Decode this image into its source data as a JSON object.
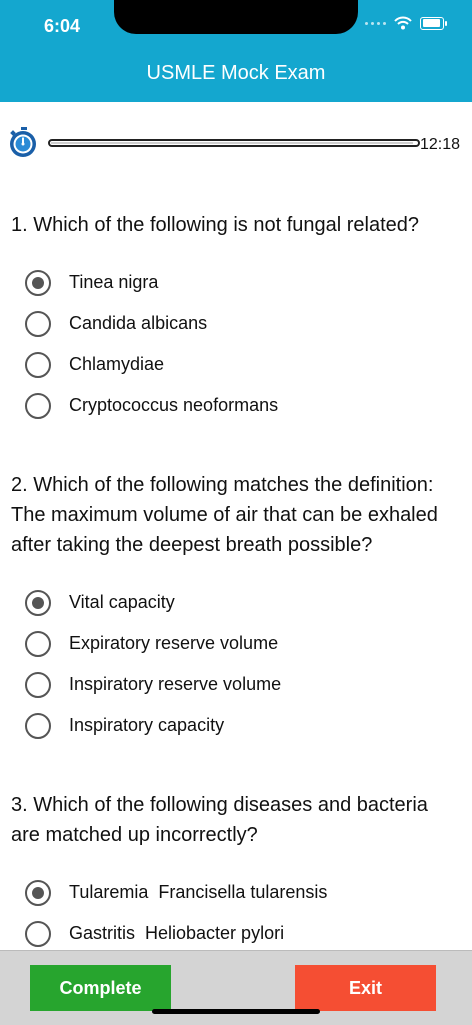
{
  "status_bar": {
    "time": "6:04"
  },
  "header": {
    "title": "USMLE Mock Exam"
  },
  "timer": {
    "remaining": "12:18",
    "progress_fraction": 0.99
  },
  "questions": [
    {
      "text": "1. Which of the following is not fungal related?",
      "options": [
        "Tinea nigra",
        "Candida albicans",
        "Chlamydiae",
        "Cryptococcus neoformans"
      ],
      "selected": 0
    },
    {
      "text": "2. Which of the following matches the definition: The maximum volume of air that can be exhaled after taking the deepest breath possible?",
      "options": [
        "Vital capacity",
        "Expiratory reserve volume",
        "Inspiratory reserve volume",
        "Inspiratory capacity"
      ],
      "selected": 0
    },
    {
      "text": "3. Which of the following diseases and bacteria are matched up incorrectly?",
      "options": [
        "Tularemia  Francisella tularensis",
        "Gastritis  Heliobacter pylori"
      ],
      "selected": 0
    }
  ],
  "buttons": {
    "complete": "Complete",
    "exit": "Exit"
  },
  "colors": {
    "header": "#14a7cf",
    "complete": "#27a52e",
    "exit": "#f54e33"
  }
}
